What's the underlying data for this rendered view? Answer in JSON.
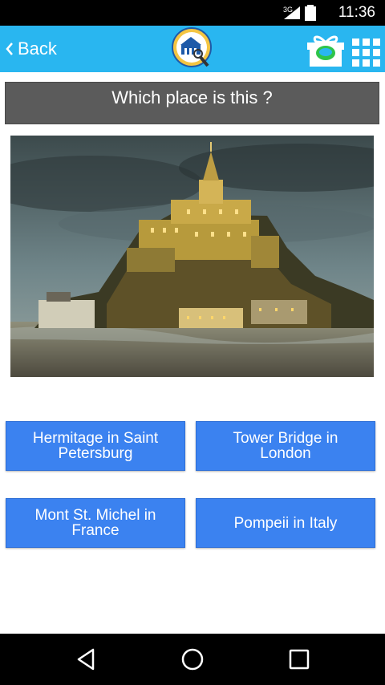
{
  "status_bar": {
    "network": "3G",
    "time": "11:36"
  },
  "app_bar": {
    "back_label": "Back"
  },
  "question": {
    "text": "Which place is this ?"
  },
  "answers": [
    {
      "label": "Hermitage in Saint Petersburg"
    },
    {
      "label": "Tower Bridge in London"
    },
    {
      "label": "Mont St. Michel in France"
    },
    {
      "label": "Pompeii in Italy"
    }
  ],
  "colors": {
    "app_bar": "#29b6f0",
    "answer_button": "#3b82f0",
    "question_bar": "#5b5b5b"
  },
  "icons": {
    "back": "chevron-left-icon",
    "gift": "gift-icon",
    "grid": "grid-icon",
    "nav_back": "triangle-back-icon",
    "nav_home": "circle-home-icon",
    "nav_recents": "square-recents-icon"
  }
}
